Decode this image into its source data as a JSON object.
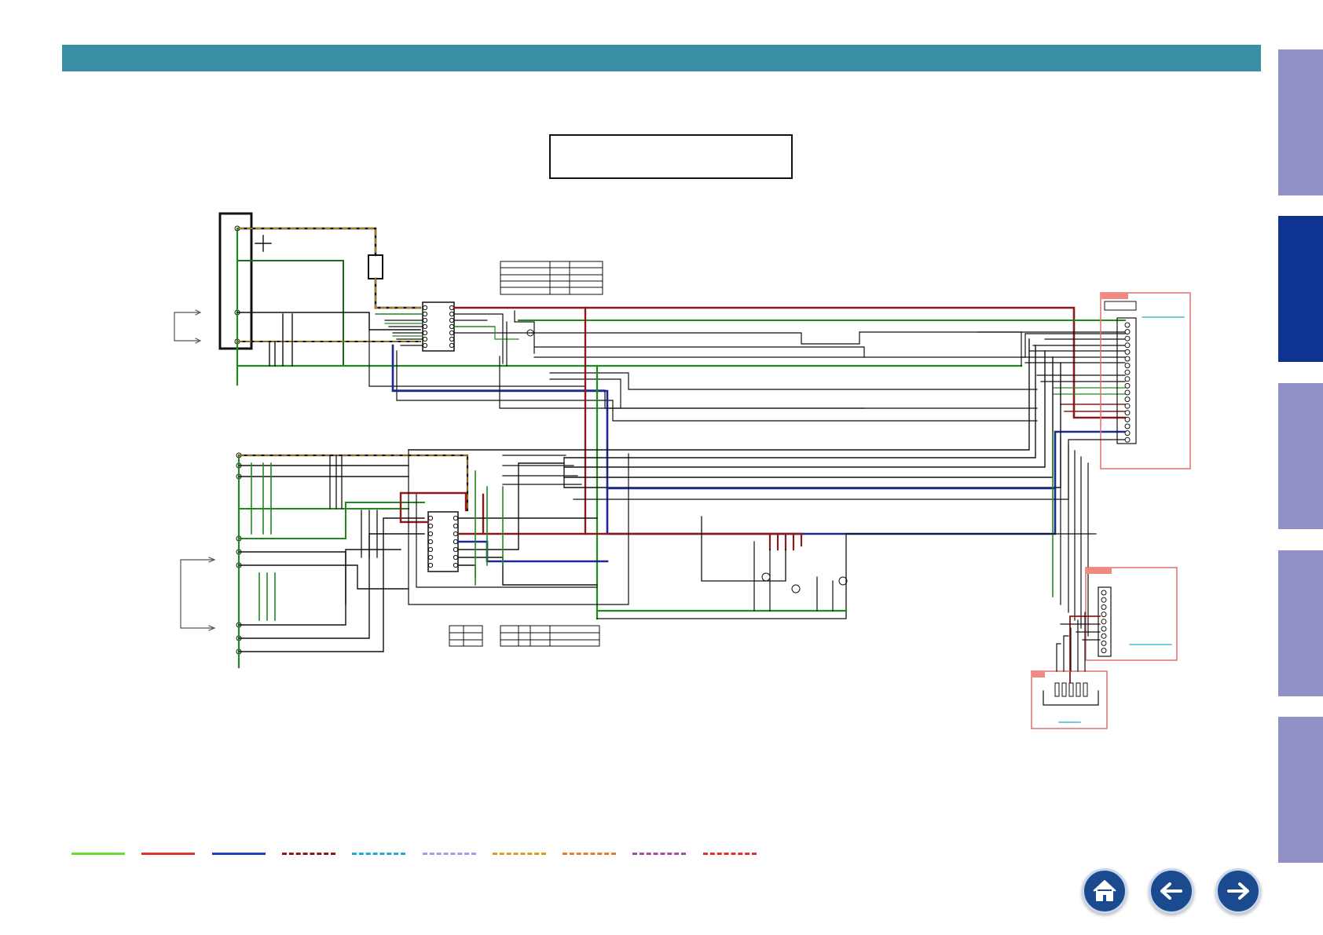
{
  "header": {
    "color": "#3a8fa5"
  },
  "side_tabs": [
    {
      "state": "inactive",
      "color": "#9191c6"
    },
    {
      "state": "active",
      "color": "#0e3391"
    },
    {
      "state": "inactive",
      "color": "#9191c6"
    },
    {
      "state": "inactive",
      "color": "#9191c6"
    },
    {
      "state": "inactive",
      "color": "#9191c6"
    }
  ],
  "wire_colors": {
    "ground": "#1f8a1f",
    "power": "#8b1a1a",
    "signal": "#1a2a8f",
    "line": "#111111",
    "connector_box": "#e07070"
  },
  "legend": [
    {
      "style": "solid",
      "color": "#66dd33"
    },
    {
      "style": "solid",
      "color": "#dd3333"
    },
    {
      "style": "solid",
      "color": "#2244bb"
    },
    {
      "style": "dashed",
      "color": "#8b1a1a"
    },
    {
      "style": "dashed",
      "color": "#22aacc"
    },
    {
      "style": "dashed",
      "color": "#a0a0e0"
    },
    {
      "style": "dashed",
      "color": "#d4a020"
    },
    {
      "style": "dashed",
      "color": "#e08030"
    },
    {
      "style": "dashed",
      "color": "#a050a0"
    },
    {
      "style": "dashed",
      "color": "#dd3333"
    }
  ],
  "nav": [
    {
      "icon": "home-icon"
    },
    {
      "icon": "arrow-left-icon"
    },
    {
      "icon": "arrow-right-icon"
    }
  ]
}
